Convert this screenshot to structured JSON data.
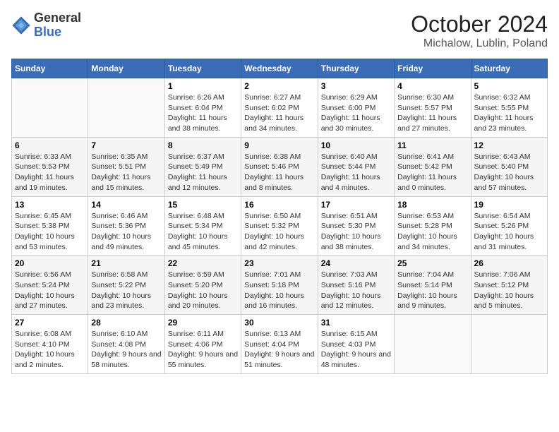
{
  "logo": {
    "line1": "General",
    "line2": "Blue"
  },
  "title": "October 2024",
  "subtitle": "Michalow, Lublin, Poland",
  "weekdays": [
    "Sunday",
    "Monday",
    "Tuesday",
    "Wednesday",
    "Thursday",
    "Friday",
    "Saturday"
  ],
  "weeks": [
    [
      {
        "day": "",
        "info": ""
      },
      {
        "day": "",
        "info": ""
      },
      {
        "day": "1",
        "info": "Sunrise: 6:26 AM\nSunset: 6:04 PM\nDaylight: 11 hours and 38 minutes."
      },
      {
        "day": "2",
        "info": "Sunrise: 6:27 AM\nSunset: 6:02 PM\nDaylight: 11 hours and 34 minutes."
      },
      {
        "day": "3",
        "info": "Sunrise: 6:29 AM\nSunset: 6:00 PM\nDaylight: 11 hours and 30 minutes."
      },
      {
        "day": "4",
        "info": "Sunrise: 6:30 AM\nSunset: 5:57 PM\nDaylight: 11 hours and 27 minutes."
      },
      {
        "day": "5",
        "info": "Sunrise: 6:32 AM\nSunset: 5:55 PM\nDaylight: 11 hours and 23 minutes."
      }
    ],
    [
      {
        "day": "6",
        "info": "Sunrise: 6:33 AM\nSunset: 5:53 PM\nDaylight: 11 hours and 19 minutes."
      },
      {
        "day": "7",
        "info": "Sunrise: 6:35 AM\nSunset: 5:51 PM\nDaylight: 11 hours and 15 minutes."
      },
      {
        "day": "8",
        "info": "Sunrise: 6:37 AM\nSunset: 5:49 PM\nDaylight: 11 hours and 12 minutes."
      },
      {
        "day": "9",
        "info": "Sunrise: 6:38 AM\nSunset: 5:46 PM\nDaylight: 11 hours and 8 minutes."
      },
      {
        "day": "10",
        "info": "Sunrise: 6:40 AM\nSunset: 5:44 PM\nDaylight: 11 hours and 4 minutes."
      },
      {
        "day": "11",
        "info": "Sunrise: 6:41 AM\nSunset: 5:42 PM\nDaylight: 11 hours and 0 minutes."
      },
      {
        "day": "12",
        "info": "Sunrise: 6:43 AM\nSunset: 5:40 PM\nDaylight: 10 hours and 57 minutes."
      }
    ],
    [
      {
        "day": "13",
        "info": "Sunrise: 6:45 AM\nSunset: 5:38 PM\nDaylight: 10 hours and 53 minutes."
      },
      {
        "day": "14",
        "info": "Sunrise: 6:46 AM\nSunset: 5:36 PM\nDaylight: 10 hours and 49 minutes."
      },
      {
        "day": "15",
        "info": "Sunrise: 6:48 AM\nSunset: 5:34 PM\nDaylight: 10 hours and 45 minutes."
      },
      {
        "day": "16",
        "info": "Sunrise: 6:50 AM\nSunset: 5:32 PM\nDaylight: 10 hours and 42 minutes."
      },
      {
        "day": "17",
        "info": "Sunrise: 6:51 AM\nSunset: 5:30 PM\nDaylight: 10 hours and 38 minutes."
      },
      {
        "day": "18",
        "info": "Sunrise: 6:53 AM\nSunset: 5:28 PM\nDaylight: 10 hours and 34 minutes."
      },
      {
        "day": "19",
        "info": "Sunrise: 6:54 AM\nSunset: 5:26 PM\nDaylight: 10 hours and 31 minutes."
      }
    ],
    [
      {
        "day": "20",
        "info": "Sunrise: 6:56 AM\nSunset: 5:24 PM\nDaylight: 10 hours and 27 minutes."
      },
      {
        "day": "21",
        "info": "Sunrise: 6:58 AM\nSunset: 5:22 PM\nDaylight: 10 hours and 23 minutes."
      },
      {
        "day": "22",
        "info": "Sunrise: 6:59 AM\nSunset: 5:20 PM\nDaylight: 10 hours and 20 minutes."
      },
      {
        "day": "23",
        "info": "Sunrise: 7:01 AM\nSunset: 5:18 PM\nDaylight: 10 hours and 16 minutes."
      },
      {
        "day": "24",
        "info": "Sunrise: 7:03 AM\nSunset: 5:16 PM\nDaylight: 10 hours and 12 minutes."
      },
      {
        "day": "25",
        "info": "Sunrise: 7:04 AM\nSunset: 5:14 PM\nDaylight: 10 hours and 9 minutes."
      },
      {
        "day": "26",
        "info": "Sunrise: 7:06 AM\nSunset: 5:12 PM\nDaylight: 10 hours and 5 minutes."
      }
    ],
    [
      {
        "day": "27",
        "info": "Sunrise: 6:08 AM\nSunset: 4:10 PM\nDaylight: 10 hours and 2 minutes."
      },
      {
        "day": "28",
        "info": "Sunrise: 6:10 AM\nSunset: 4:08 PM\nDaylight: 9 hours and 58 minutes."
      },
      {
        "day": "29",
        "info": "Sunrise: 6:11 AM\nSunset: 4:06 PM\nDaylight: 9 hours and 55 minutes."
      },
      {
        "day": "30",
        "info": "Sunrise: 6:13 AM\nSunset: 4:04 PM\nDaylight: 9 hours and 51 minutes."
      },
      {
        "day": "31",
        "info": "Sunrise: 6:15 AM\nSunset: 4:03 PM\nDaylight: 9 hours and 48 minutes."
      },
      {
        "day": "",
        "info": ""
      },
      {
        "day": "",
        "info": ""
      }
    ]
  ]
}
